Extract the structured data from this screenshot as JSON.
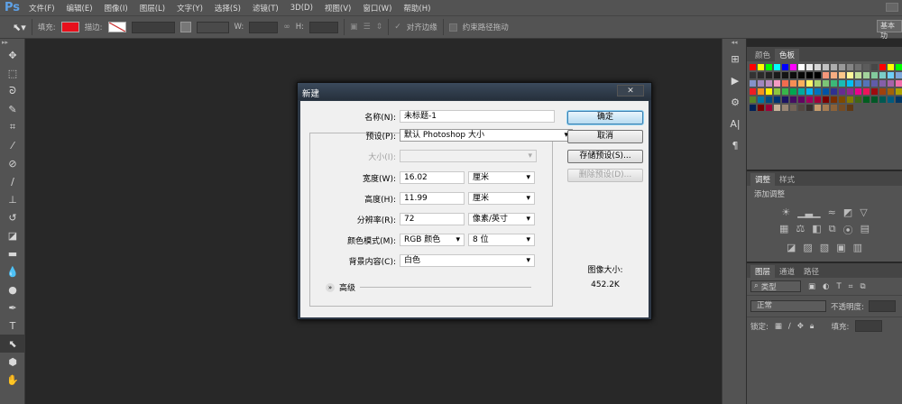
{
  "app": {
    "logo": "Ps"
  },
  "menu": [
    "文件(F)",
    "编辑(E)",
    "图像(I)",
    "图层(L)",
    "文字(Y)",
    "选择(S)",
    "滤镜(T)",
    "3D(D)",
    "视图(V)",
    "窗口(W)",
    "帮助(H)"
  ],
  "options": {
    "fill_label": "填充:",
    "fill_color": "#e8101c",
    "stroke_label": "描边:",
    "w_label": "W:",
    "h_label": "H:",
    "align_edges": "对齐边缘",
    "constrain_path": "约束路径拖动",
    "workspace": "基本功"
  },
  "swatches_panel": {
    "tabs": [
      "颜色",
      "色板"
    ],
    "active": 1,
    "colors": [
      "#ff0000",
      "#ffff00",
      "#00ff00",
      "#00ffff",
      "#0000ff",
      "#ff00ff",
      "#ffffff",
      "#ebebeb",
      "#d6d6d6",
      "#c2c2c2",
      "#adadad",
      "#999999",
      "#858585",
      "#707070",
      "#5c5c5c",
      "#474747",
      "#ff0000",
      "#ffff00",
      "#00ff00",
      "#333333",
      "#2a2a2a",
      "#222222",
      "#1a1a1a",
      "#141414",
      "#0d0d0d",
      "#080808",
      "#000000",
      "#000000",
      "#f7977a",
      "#f9ad81",
      "#fdc68a",
      "#fff79a",
      "#c4df9b",
      "#a3d39c",
      "#82ca9d",
      "#7bcdc8",
      "#6ecff6",
      "#7ea7d8",
      "#8493ca",
      "#a187be",
      "#bc8dbf",
      "#f49ac2",
      "#f26c4f",
      "#f68e55",
      "#fbaf5c",
      "#fff467",
      "#acd372",
      "#7cc576",
      "#3bb878",
      "#1abbb4",
      "#00bff3",
      "#438ccb",
      "#5574b9",
      "#605ca8",
      "#855fa8",
      "#a763a8",
      "#f06eaa",
      "#ed1c24",
      "#f7941d",
      "#fff200",
      "#8dc63f",
      "#39b54a",
      "#00a651",
      "#00a99d",
      "#00aeef",
      "#0072bc",
      "#0054a6",
      "#2e3192",
      "#662d91",
      "#92278f",
      "#ec008c",
      "#ed145b",
      "#9e0b0f",
      "#a0410d",
      "#a36209",
      "#aba000",
      "#598527",
      "#0076a3",
      "#004a80",
      "#003471",
      "#1b1464",
      "#440e62",
      "#630460",
      "#9e005d",
      "#9e0039",
      "#790000",
      "#7b2e00",
      "#7d4900",
      "#827b00",
      "#406618",
      "#005e20",
      "#005826",
      "#005952",
      "#005b7f",
      "#003663",
      "#002157",
      "#790000",
      "#9e0039",
      "#c7b299",
      "#998675",
      "#736357",
      "#534741",
      "#37302d",
      "#c69c6d",
      "#a67c52",
      "#8c6239",
      "#754c24",
      "#603913"
    ]
  },
  "adjust_panel": {
    "tabs": [
      "调整",
      "样式"
    ],
    "title": "添加调整"
  },
  "layers_panel": {
    "tabs": [
      "图层",
      "通道",
      "路径"
    ],
    "filter": "类型",
    "blend": "正常",
    "opacity_label": "不透明度:",
    "lock_label": "锁定:",
    "fill_label": "填充:"
  },
  "dialog": {
    "title": "新建",
    "close": "✕",
    "name_label": "名称(N):",
    "name_value": "未标题-1",
    "preset_label": "预设(P):",
    "preset_value": "默认 Photoshop 大小",
    "size_label": "大小(I):",
    "width_label": "宽度(W):",
    "width_value": "16.02",
    "width_unit": "厘米",
    "height_label": "高度(H):",
    "height_value": "11.99",
    "height_unit": "厘米",
    "res_label": "分辨率(R):",
    "res_value": "72",
    "res_unit": "像素/英寸",
    "mode_label": "颜色模式(M):",
    "mode_value": "RGB 颜色",
    "depth_value": "8 位",
    "bg_label": "背景内容(C):",
    "bg_value": "白色",
    "advanced": "高级",
    "ok": "确定",
    "cancel": "取消",
    "save_preset": "存储预设(S)...",
    "delete_preset": "删除预设(D)...",
    "image_size_label": "图像大小:",
    "image_size_value": "452.2K"
  }
}
